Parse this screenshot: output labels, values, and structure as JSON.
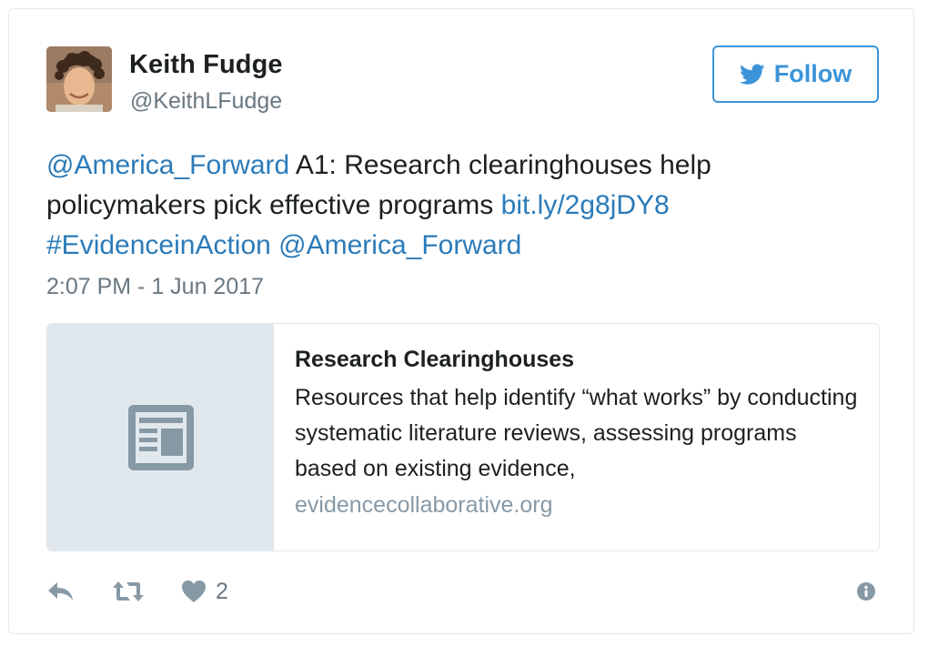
{
  "author": {
    "name": "Keith Fudge",
    "handle": "@KeithLFudge"
  },
  "follow_button": {
    "label": "Follow",
    "icon": "twitter-bird-icon"
  },
  "tweet": {
    "mention_1": "@America_Forward",
    "text_1": " A1: Research clearinghouses help policymakers pick effective programs ",
    "link": "bit.ly/2g8jDY8",
    "hashtag": "#EvidenceinAction",
    "mention_2": "@America_Forward",
    "timestamp": "2:07 PM - 1 Jun 2017"
  },
  "card": {
    "thumb_icon": "article-icon",
    "title": "Research Clearinghouses",
    "description": "Resources that help identify “what works” by conducting systematic literature reviews, assessing programs based on existing evidence,",
    "domain": "evidencecollaborative.org"
  },
  "actions": {
    "reply_icon": "reply-icon",
    "retweet_icon": "retweet-icon",
    "like_icon": "heart-icon",
    "like_count": "2",
    "info_icon": "info-icon"
  },
  "colors": {
    "link_blue": "#2b7bb9",
    "follow_blue": "#3b94d9",
    "text_dark": "#1c2022",
    "text_gray": "#697882",
    "icon_gray": "#8899a6",
    "card_thumb_bg": "#e1e8ed"
  }
}
